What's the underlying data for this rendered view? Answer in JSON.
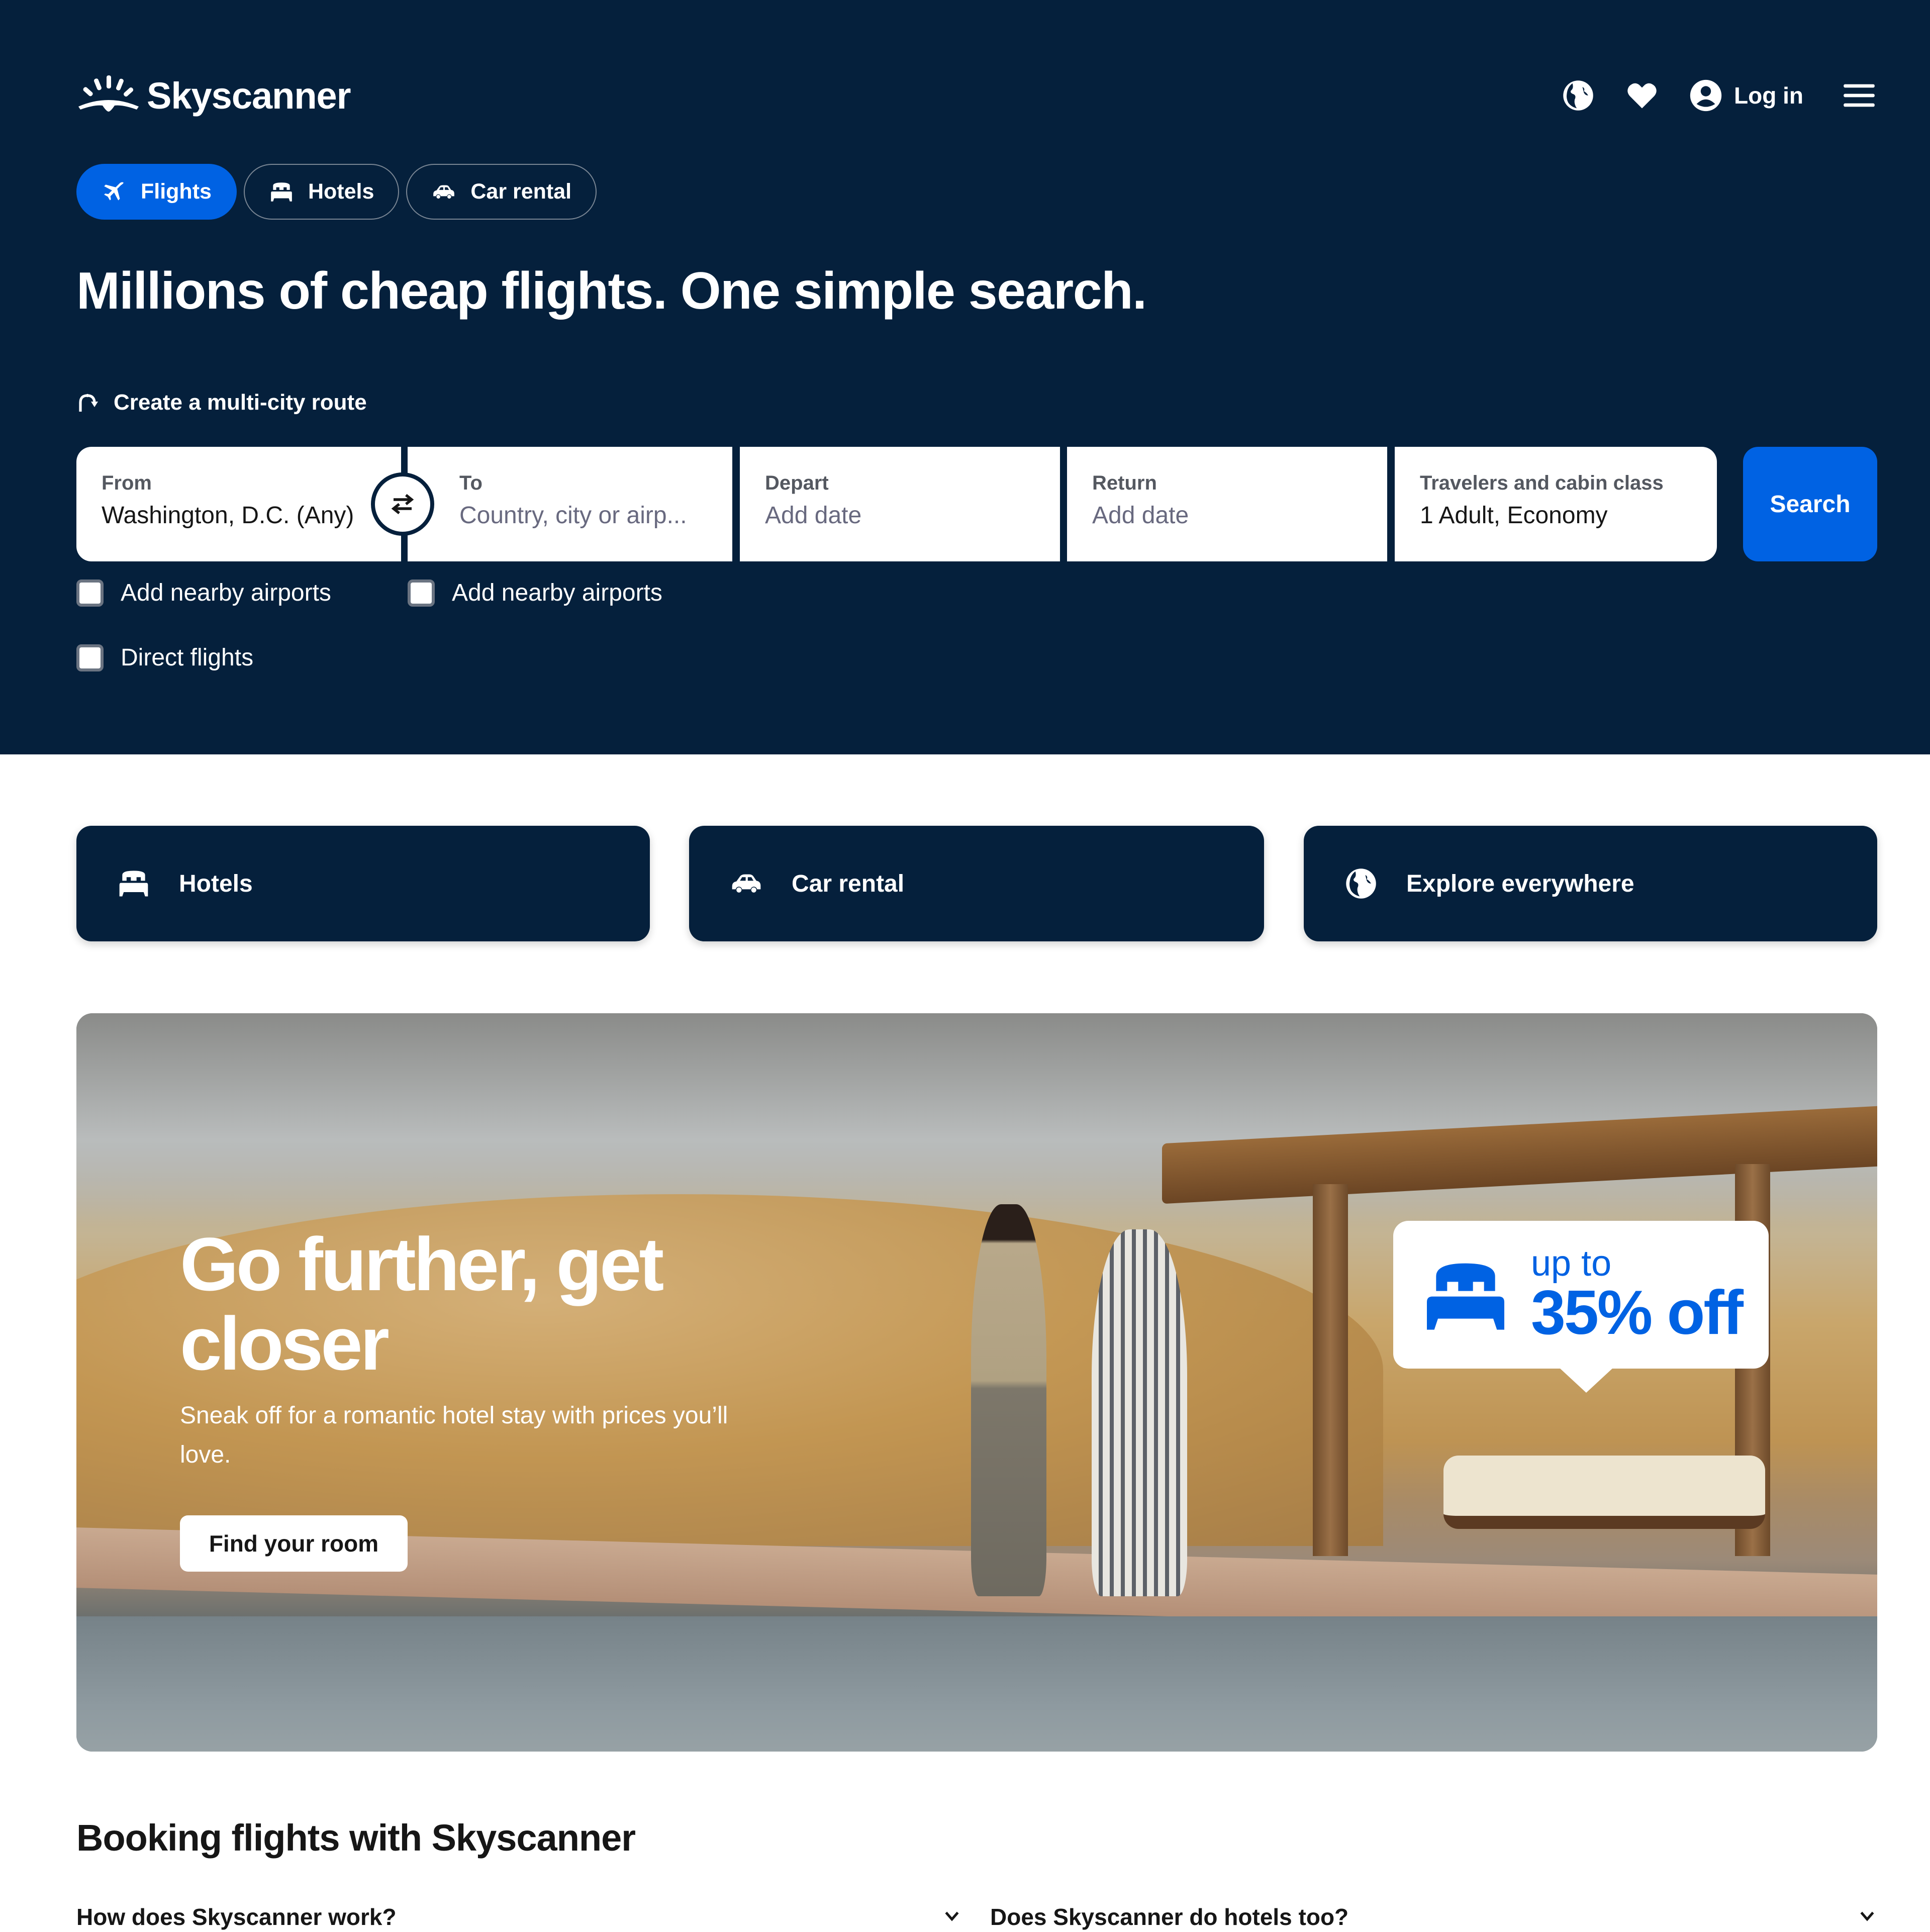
{
  "brand": {
    "name": "Skyscanner"
  },
  "header": {
    "icons": [
      "globe-icon",
      "heart-icon",
      "account-icon"
    ],
    "login_label": "Log in",
    "menu_icon": "hamburger-menu-icon"
  },
  "tabs": [
    {
      "label": "Flights",
      "icon": "plane-icon",
      "active": true
    },
    {
      "label": "Hotels",
      "icon": "bed-icon",
      "active": false
    },
    {
      "label": "Car rental",
      "icon": "car-icon",
      "active": false
    }
  ],
  "headline": "Millions of cheap flights. One simple search.",
  "multi_city_label": "Create a multi-city route",
  "search": {
    "from": {
      "label": "From",
      "value": "Washington, D.C. (Any)"
    },
    "to": {
      "label": "To",
      "placeholder": "Country, city or airp..."
    },
    "depart": {
      "label": "Depart",
      "placeholder": "Add date"
    },
    "return": {
      "label": "Return",
      "placeholder": "Add date"
    },
    "travelers": {
      "label": "Travelers and cabin class",
      "value": "1 Adult, Economy"
    },
    "button_label": "Search",
    "checkboxes": [
      {
        "label": "Add nearby airports",
        "checked": false
      },
      {
        "label": "Add nearby airports",
        "checked": false
      },
      {
        "label": "Direct flights",
        "checked": false
      }
    ]
  },
  "quick_links": [
    {
      "label": "Hotels",
      "icon": "bed-icon"
    },
    {
      "label": "Car rental",
      "icon": "car-icon"
    },
    {
      "label": "Explore everywhere",
      "icon": "globe-icon"
    }
  ],
  "promo": {
    "title": "Go further, get closer",
    "subtitle": "Sneak off for a romantic hotel stay with prices you’ll love.",
    "button_label": "Find your room",
    "badge": {
      "line1": "up to",
      "line2": "35% off",
      "icon": "bed-icon"
    }
  },
  "booking": {
    "title": "Booking flights with Skyscanner",
    "faqs": [
      {
        "question": "How does Skyscanner work?"
      },
      {
        "question": "Does Skyscanner do hotels too?"
      }
    ]
  },
  "colors": {
    "navy": "#05203c",
    "accent_blue": "#0062e3",
    "white": "#ffffff"
  }
}
